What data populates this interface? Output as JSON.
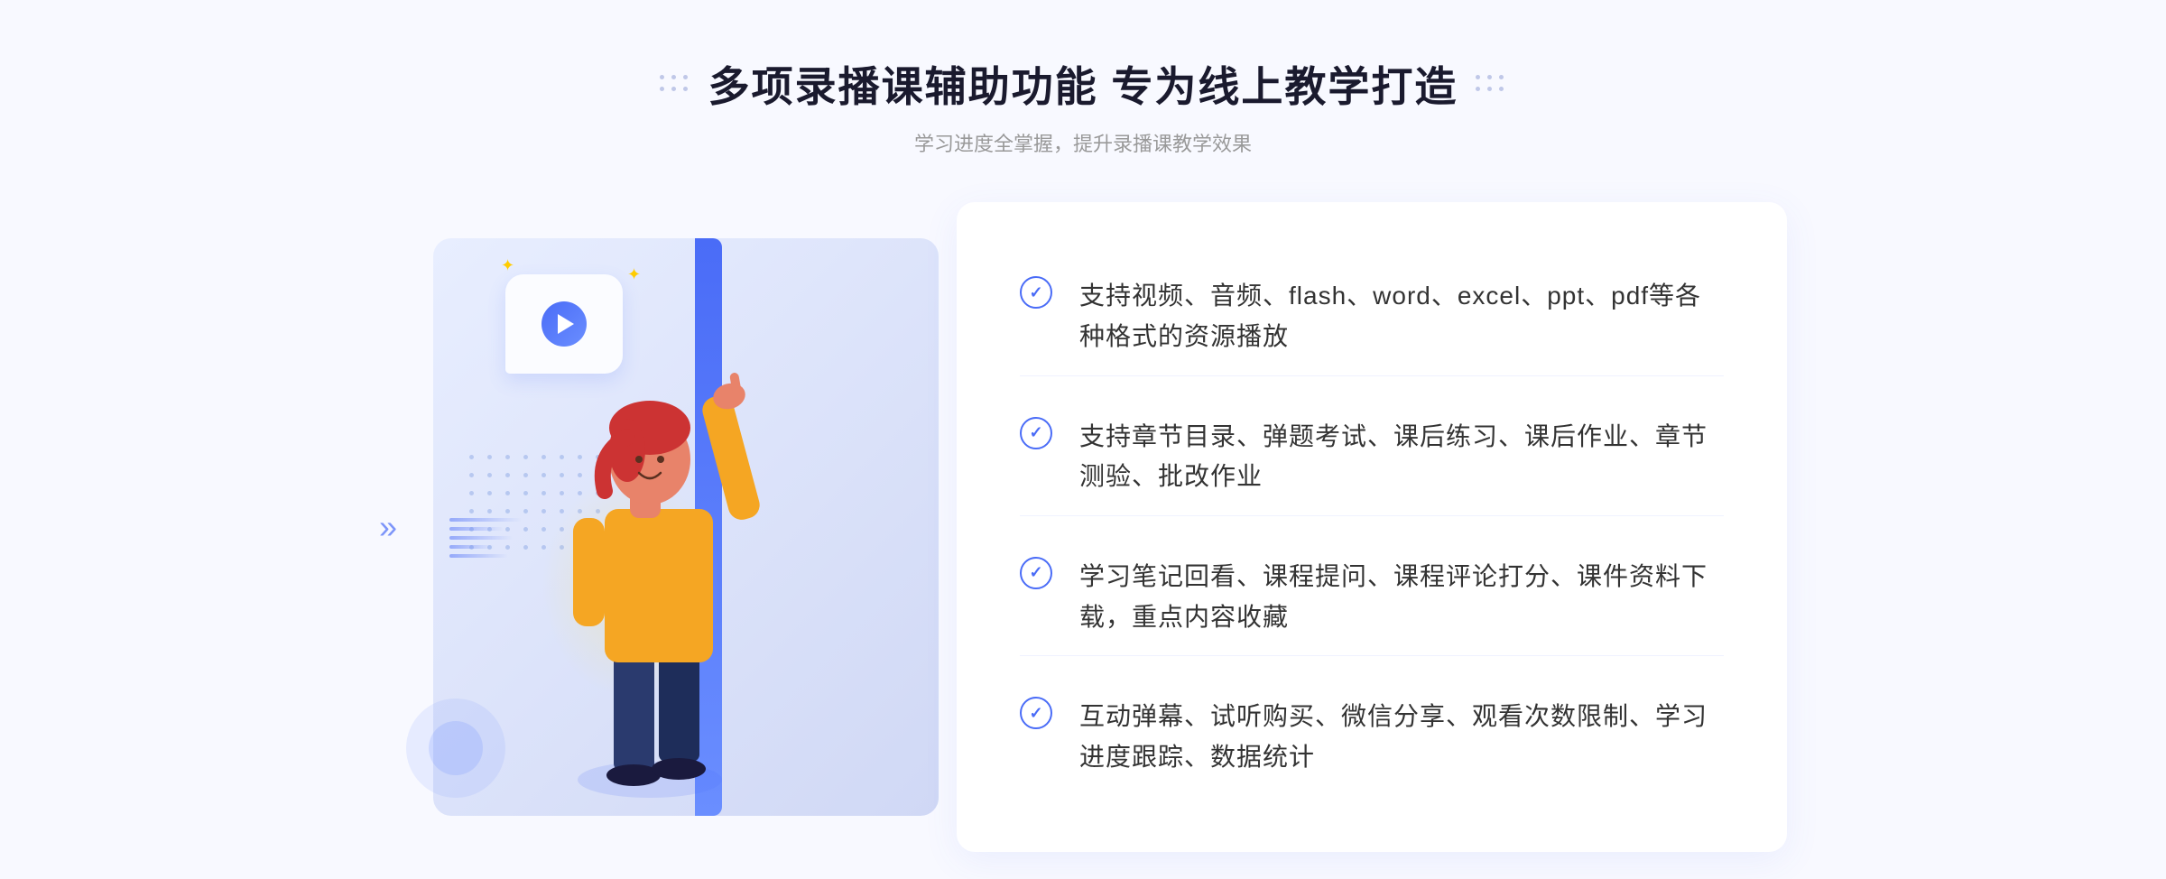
{
  "header": {
    "title": "多项录播课辅助功能 专为线上教学打造",
    "subtitle": "学习进度全掌握，提升录播课教学效果"
  },
  "features": [
    {
      "id": "feature-1",
      "text": "支持视频、音频、flash、word、excel、ppt、pdf等各种格式的资源播放"
    },
    {
      "id": "feature-2",
      "text": "支持章节目录、弹题考试、课后练习、课后作业、章节测验、批改作业"
    },
    {
      "id": "feature-3",
      "text": "学习笔记回看、课程提问、课程评论打分、课件资料下载，重点内容收藏"
    },
    {
      "id": "feature-4",
      "text": "互动弹幕、试听购买、微信分享、观看次数限制、学习进度跟踪、数据统计"
    }
  ],
  "icons": {
    "check": "✓",
    "play": "▶",
    "chevron": "»",
    "spark": "✦"
  }
}
